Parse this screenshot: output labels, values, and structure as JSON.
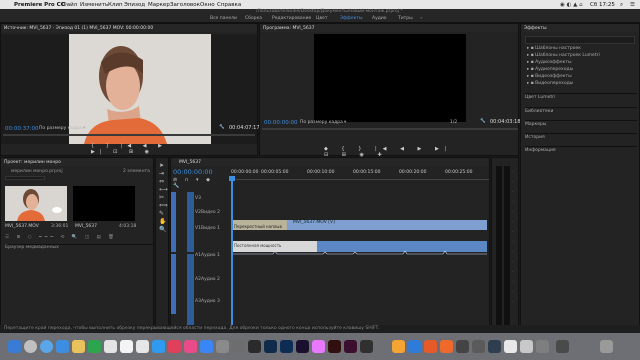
{
  "menubar": {
    "app": "Premiere Pro CC",
    "items": [
      "Файл",
      "Изменить",
      "Клип",
      "Эпизод",
      "Маркер",
      "Заголовок",
      "Окно",
      "Справка"
    ],
    "clock": "Сб 17:25"
  },
  "titlebar": {
    "path": "/Пользователи/ale/Desktop/Документы/новый-монтаж.prproj *"
  },
  "workspaces": [
    "Все панели",
    "Сборка",
    "Редактирование",
    "Цвет",
    "Эффекты",
    "Аудио",
    "Титры"
  ],
  "active_workspace": "Эффекты",
  "source": {
    "title": "Источник: MVI_5637 · Эпизод 01 (1) MVI_5637 MOV: 00:00:00:00",
    "timecode": "00:00:37:00",
    "fit": "По размеру кадра",
    "duration": "00:04:07:17"
  },
  "program": {
    "title": "Программа: MVI_5637",
    "timecode": "00:00:00:00",
    "fit": "По размеру кадра",
    "ratio": "1/2",
    "duration": "00:04:03:18"
  },
  "effects": {
    "title": "Эффекты",
    "tree": [
      "Шаблоны настроек",
      "Шаблоны настроек Lumetri",
      "Аудиоэффекты",
      "Аудиопереходы",
      "Видеоэффекты",
      "Видеопереходы"
    ],
    "sections": [
      "Цвет Lumetri",
      "Библиотеки",
      "Маркеры",
      "История",
      "Информация"
    ]
  },
  "project": {
    "title": "Проект: мерилин монро",
    "file": "мерилин монро.prproj",
    "count": "2 элемента",
    "items": [
      {
        "name": "MVI_5637.MOV",
        "duration": "3:36:01"
      },
      {
        "name": "MVI_5637",
        "duration": "4:03:18"
      }
    ],
    "footer": "Браузер медиаданных"
  },
  "timeline": {
    "tab": "MVI_5637",
    "timecode": "00:00:00:00",
    "ruler": [
      "00:00:00:00",
      "00:00:05:00",
      "00:00:10:00",
      "00:00:15:00",
      "00:00:20:00",
      "00:00:25:00"
    ],
    "tracks": [
      {
        "id": "V3",
        "label": ""
      },
      {
        "id": "V2",
        "label": "Видео 2"
      },
      {
        "id": "V1",
        "label": "Видео 1"
      },
      {
        "id": "A1",
        "label": "Аудио 1"
      },
      {
        "id": "A2",
        "label": "Аудио 2"
      },
      {
        "id": "A3",
        "label": "Аудио 3"
      }
    ],
    "clips": {
      "v1_transition": "Перекрестный наплыв",
      "v1_clip": "MVI_5637.MOV [V]",
      "a1_transition": "Постоянная мощность"
    }
  },
  "status": "Перетащите край перехода, чтобы выполнить обрезку перекрывающейся области перехода. Для обрезки только одного конца используйте клавишу SHIFT.",
  "colors": {
    "accent": "#3d8ee0",
    "clip_video": "#7e9fcf",
    "clip_audio": "#5b88c5"
  }
}
